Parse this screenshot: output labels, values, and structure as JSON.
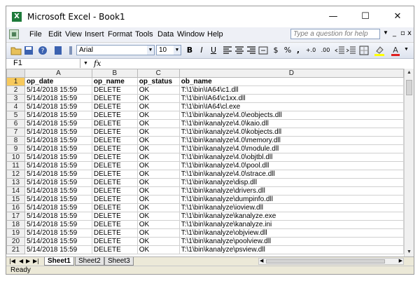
{
  "window": {
    "title": "Microsoft Excel - Book1",
    "app_icon": "X",
    "controls": [
      "—",
      "☐",
      "✕"
    ]
  },
  "menubar": {
    "items": [
      "File",
      "Edit",
      "View",
      "Insert",
      "Format",
      "Tools",
      "Data",
      "Window",
      "Help"
    ],
    "question_placeholder": "Type a question for help",
    "doc_controls": [
      "_",
      "▫",
      "x"
    ]
  },
  "toolbar": {
    "font_name": "Arial",
    "font_size": "10",
    "bold": "B",
    "italic": "I",
    "underline": "U",
    "currency": "$",
    "percent": "%",
    "comma": ",",
    "inc_decimal": "+.0",
    "dec_decimal": ".00"
  },
  "formula_bar": {
    "name_box": "F1",
    "fx": "fx",
    "content": ""
  },
  "sheet": {
    "columns": [
      "A",
      "B",
      "C",
      "D"
    ],
    "header_row": [
      "op_date",
      "op_name",
      "op_status",
      "ob_name"
    ],
    "rows": [
      [
        "5/14/2018 15:59",
        "DELETE",
        "OK",
        "T:\\1\\bin\\IA64\\c1.dll"
      ],
      [
        "5/14/2018 15:59",
        "DELETE",
        "OK",
        "T:\\1\\bin\\IA64\\c1xx.dll"
      ],
      [
        "5/14/2018 15:59",
        "DELETE",
        "OK",
        "T:\\1\\bin\\IA64\\cl.exe"
      ],
      [
        "5/14/2018 15:59",
        "DELETE",
        "OK",
        "T:\\1\\bin\\kanalyze\\4.0\\eobjects.dll"
      ],
      [
        "5/14/2018 15:59",
        "DELETE",
        "OK",
        "T:\\1\\bin\\kanalyze\\4.0\\kaio.dll"
      ],
      [
        "5/14/2018 15:59",
        "DELETE",
        "OK",
        "T:\\1\\bin\\kanalyze\\4.0\\kobjects.dll"
      ],
      [
        "5/14/2018 15:59",
        "DELETE",
        "OK",
        "T:\\1\\bin\\kanalyze\\4.0\\memory.dll"
      ],
      [
        "5/14/2018 15:59",
        "DELETE",
        "OK",
        "T:\\1\\bin\\kanalyze\\4.0\\module.dll"
      ],
      [
        "5/14/2018 15:59",
        "DELETE",
        "OK",
        "T:\\1\\bin\\kanalyze\\4.0\\objtbl.dll"
      ],
      [
        "5/14/2018 15:59",
        "DELETE",
        "OK",
        "T:\\1\\bin\\kanalyze\\4.0\\pool.dll"
      ],
      [
        "5/14/2018 15:59",
        "DELETE",
        "OK",
        "T:\\1\\bin\\kanalyze\\4.0\\strace.dll"
      ],
      [
        "5/14/2018 15:59",
        "DELETE",
        "OK",
        "T:\\1\\bin\\kanalyze\\disp.dll"
      ],
      [
        "5/14/2018 15:59",
        "DELETE",
        "OK",
        "T:\\1\\bin\\kanalyze\\drivers.dll"
      ],
      [
        "5/14/2018 15:59",
        "DELETE",
        "OK",
        "T:\\1\\bin\\kanalyze\\dumpinfo.dll"
      ],
      [
        "5/14/2018 15:59",
        "DELETE",
        "OK",
        "T:\\1\\bin\\kanalyze\\ioview.dll"
      ],
      [
        "5/14/2018 15:59",
        "DELETE",
        "OK",
        "T:\\1\\bin\\kanalyze\\kanalyze.exe"
      ],
      [
        "5/14/2018 15:59",
        "DELETE",
        "OK",
        "T:\\1\\bin\\kanalyze\\kanalyze.ini"
      ],
      [
        "5/14/2018 15:59",
        "DELETE",
        "OK",
        "T:\\1\\bin\\kanalyze\\objview.dll"
      ],
      [
        "5/14/2018 15:59",
        "DELETE",
        "OK",
        "T:\\1\\bin\\kanalyze\\poolview.dll"
      ],
      [
        "5/14/2018 15:59",
        "DELETE",
        "OK",
        "T:\\1\\bin\\kanalyze\\psview.dll"
      ]
    ]
  },
  "tabs": {
    "items": [
      "Sheet1",
      "Sheet2",
      "Sheet3"
    ],
    "active": "Sheet1",
    "nav": [
      "|◀",
      "◀",
      "▶",
      "▶|"
    ]
  },
  "status": {
    "text": "Ready"
  },
  "colors": {
    "excel_green": "#1d7a3a",
    "selected_header": "#f7c95c",
    "header_gray": "#f0f0f0"
  }
}
